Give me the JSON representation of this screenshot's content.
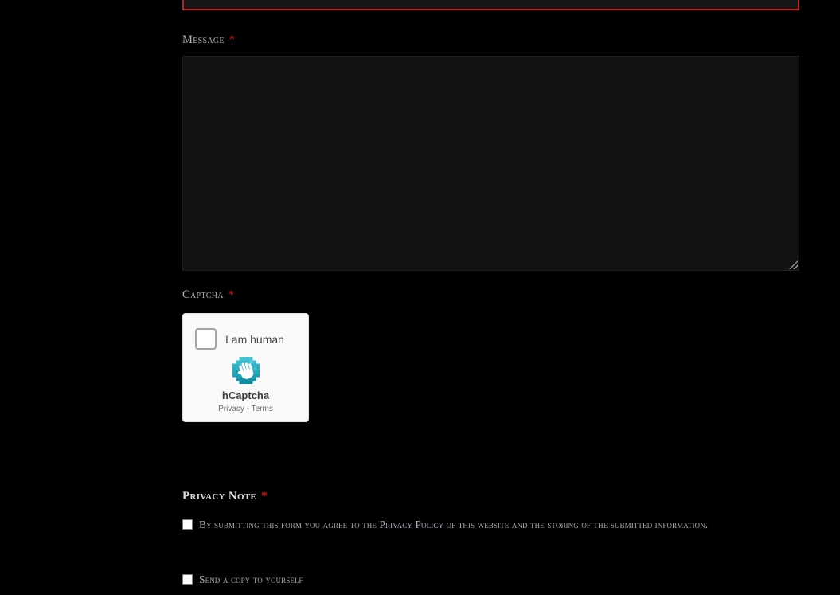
{
  "colors": {
    "page_bg": "#000000",
    "accent_red_border": "#c41f1f",
    "asterisk_red": "#e01a1a",
    "hcaptcha_teal": "#2fb5c7",
    "hcaptcha_widget_bg": "#fafafa"
  },
  "form": {
    "top_field": {
      "value": ""
    },
    "message": {
      "label": "Message",
      "required_mark": "*",
      "value": ""
    },
    "captcha": {
      "label": "Captcha",
      "required_mark": "*",
      "widget": {
        "checkbox_label": "I am human",
        "brand": "hCaptcha",
        "privacy_link": "Privacy",
        "separator": " - ",
        "terms_link": "Terms"
      }
    },
    "privacy_note": {
      "label": "Privacy Note",
      "required_mark": "*",
      "agree_text_before": "By submitting this form you agree to the ",
      "privacy_policy_link": "Privacy Policy",
      "agree_text_after": " of this website and the storing of the submitted information."
    },
    "send_copy": {
      "label": "Send a copy to yourself"
    }
  }
}
